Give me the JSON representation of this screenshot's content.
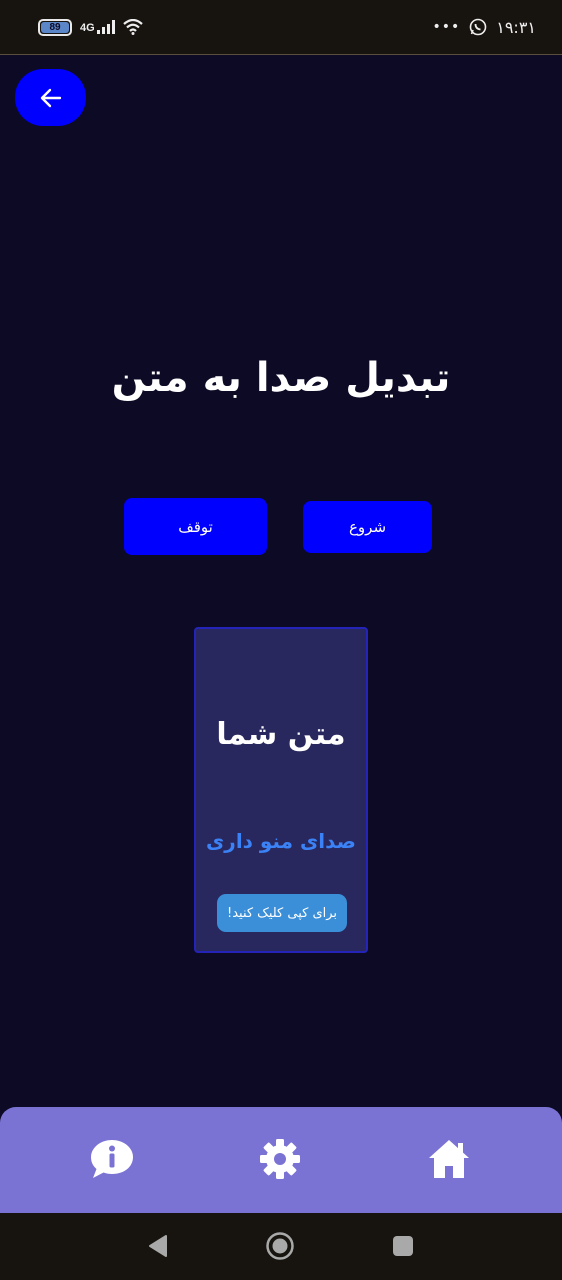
{
  "status_bar": {
    "battery_level": "89",
    "network_type": "4G",
    "overflow_dots": "•••",
    "time": "۱۹:۳۱"
  },
  "header": {
    "back_icon": "arrow-left-icon"
  },
  "main": {
    "title": "تبدیل صدا به متن",
    "stop_label": "توقف",
    "start_label": "شروع"
  },
  "result_card": {
    "title": "متن شما",
    "recognized_text": "صدای منو داری",
    "copy_label": "برای کپی کلیک کنید!"
  },
  "bottom_nav": {
    "items": [
      {
        "icon": "info-chat-icon"
      },
      {
        "icon": "gear-icon"
      },
      {
        "icon": "home-icon"
      }
    ]
  },
  "colors": {
    "background": "#0d0a26",
    "accent_blue": "#0000ff",
    "card": "#28275e",
    "recognized_text": "#3b82f6",
    "copy_button": "#3a8fd8",
    "bottom_nav": "#7b73d4"
  }
}
